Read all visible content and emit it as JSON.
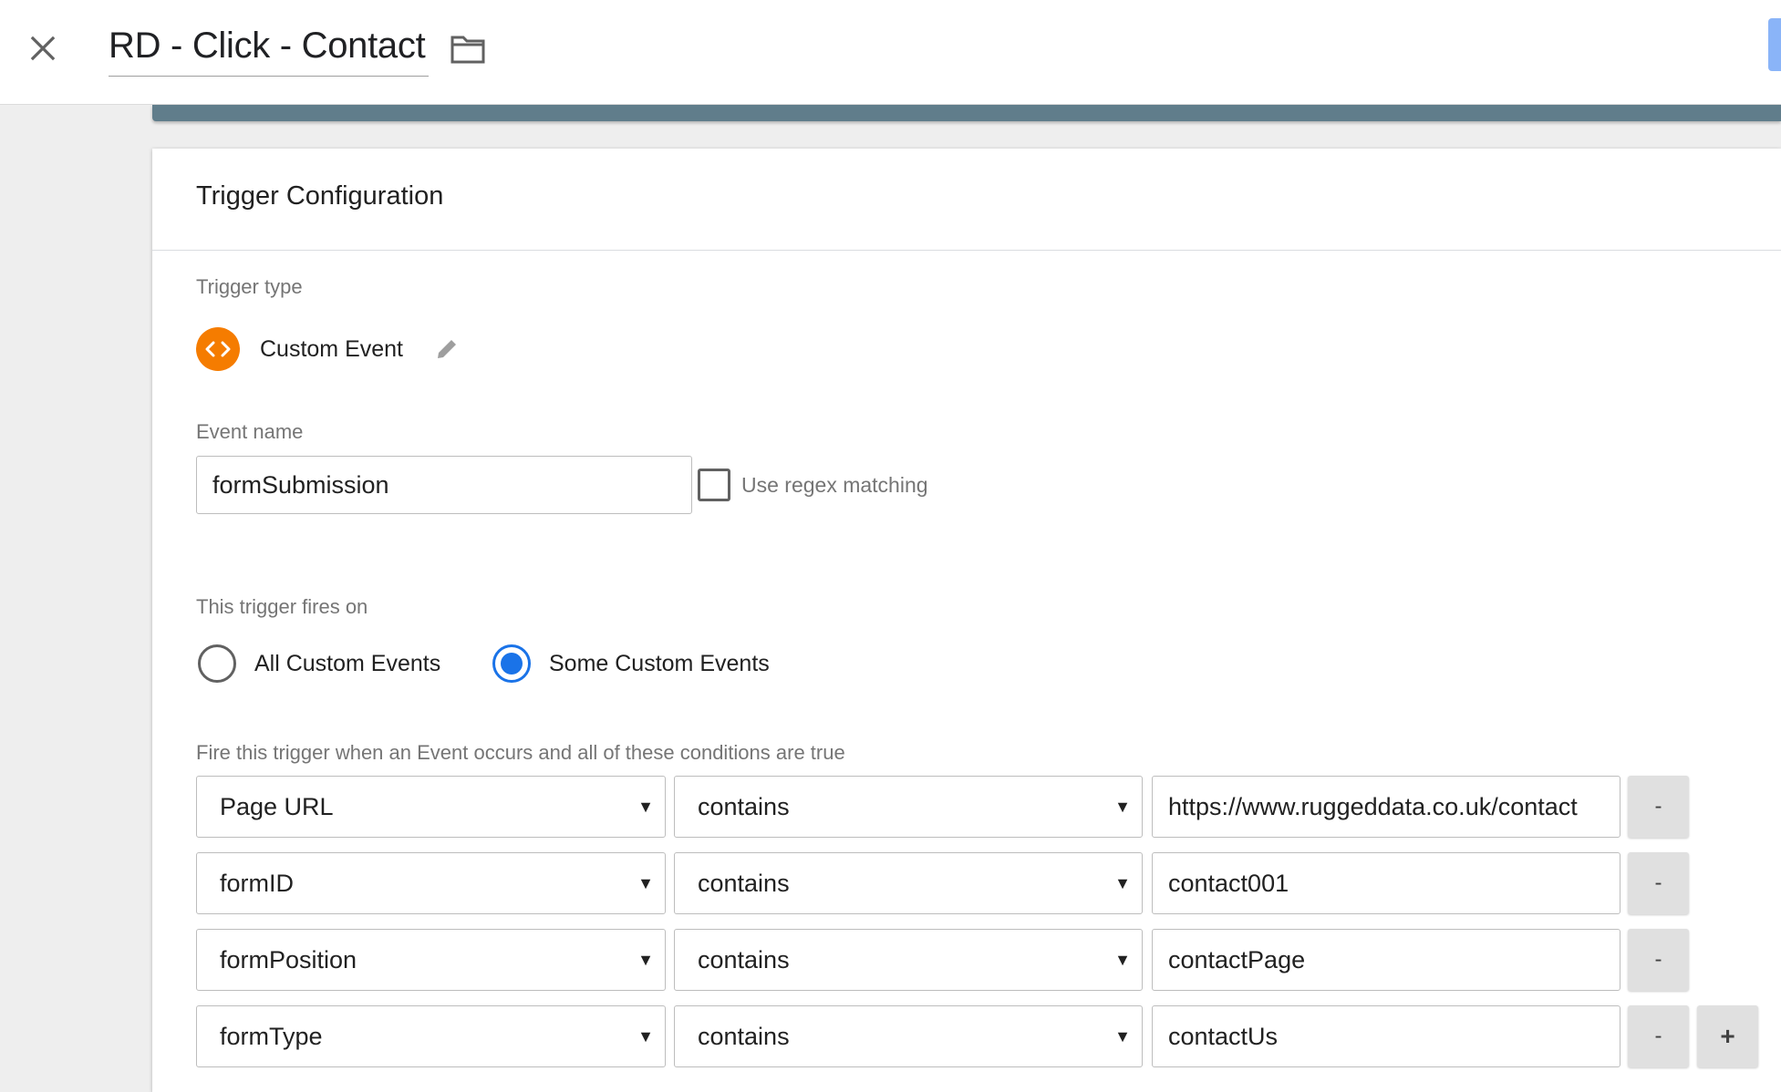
{
  "header": {
    "title": "RD - Click - Contact",
    "close_icon": "close-icon",
    "folder_icon": "folder-icon",
    "accent_color": "#8ab4f8"
  },
  "card": {
    "title": "Trigger Configuration",
    "trigger_type_label": "Trigger type",
    "trigger_type": {
      "name": "Custom Event",
      "icon": "code-brackets-icon",
      "icon_color": "#f57c00",
      "edit_icon": "pencil-icon"
    },
    "event_name_label": "Event name",
    "event_name_value": "formSubmission",
    "regex_label": "Use regex matching",
    "regex_checked": false,
    "fires_on_label": "This trigger fires on",
    "fires_on_options": [
      {
        "label": "All Custom Events",
        "selected": false
      },
      {
        "label": "Some Custom Events",
        "selected": true
      }
    ],
    "conditions_label": "Fire this trigger when an Event occurs and all of these conditions are true",
    "conditions": [
      {
        "variable": "Page URL",
        "operator": "contains",
        "value": "https://www.ruggeddata.co.uk/contact"
      },
      {
        "variable": "formID",
        "operator": "contains",
        "value": "contact001"
      },
      {
        "variable": "formPosition",
        "operator": "contains",
        "value": "contactPage"
      },
      {
        "variable": "formType",
        "operator": "contains",
        "value": "contactUs"
      }
    ],
    "remove_label": "-",
    "add_label": "+",
    "radio_color": "#1a73e8",
    "strip_color": "#607d8b"
  }
}
